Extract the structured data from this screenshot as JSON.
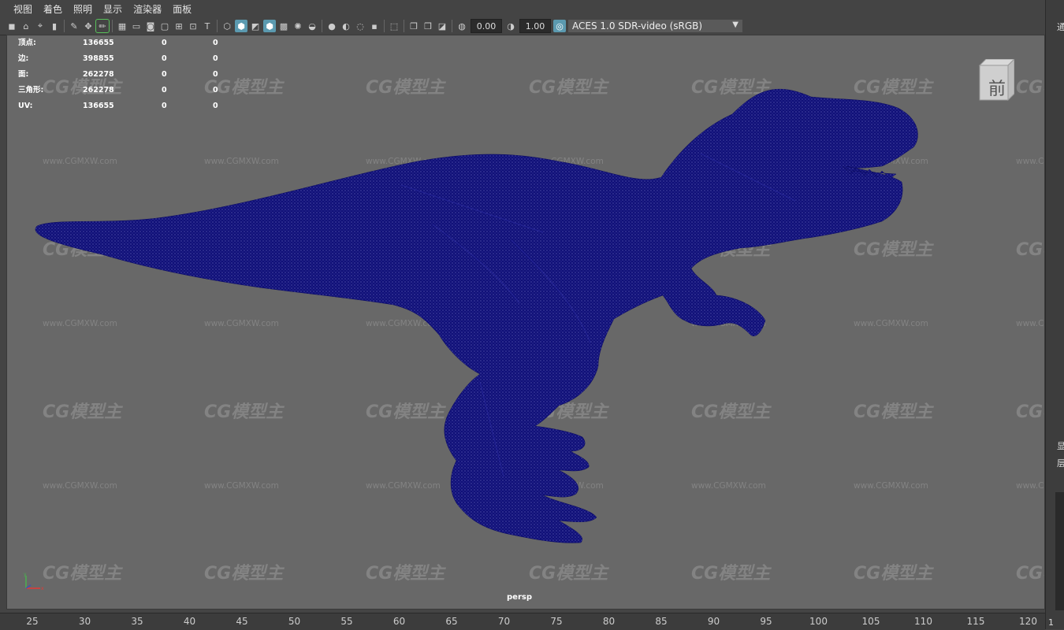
{
  "menubar": {
    "items": [
      "视图",
      "着色",
      "照明",
      "显示",
      "渲染器",
      "面板"
    ]
  },
  "toolbar": {
    "exposure_value": "0.00",
    "gamma_value": "1.00",
    "color_space": "ACES 1.0 SDR-video (sRGB)"
  },
  "hud": {
    "rows": [
      {
        "label": "顶点:",
        "a": "136655",
        "b": "0",
        "c": "0"
      },
      {
        "label": "边:",
        "a": "398855",
        "b": "0",
        "c": "0"
      },
      {
        "label": "面:",
        "a": "262278",
        "b": "0",
        "c": "0"
      },
      {
        "label": "三角形:",
        "a": "262278",
        "b": "0",
        "c": "0"
      },
      {
        "label": "UV:",
        "a": "136655",
        "b": "0",
        "c": "0"
      }
    ]
  },
  "viewcube": {
    "face_label": "前"
  },
  "viewport": {
    "camera": "persp"
  },
  "watermark": {
    "brand": "CG模型主",
    "url": "www.CGMXW.com"
  },
  "right_panel": {
    "glyphs": [
      "通",
      "显",
      "层"
    ]
  },
  "timeline": {
    "ticks": [
      "25",
      "30",
      "35",
      "40",
      "45",
      "50",
      "55",
      "60",
      "65",
      "70",
      "75",
      "80",
      "85",
      "90",
      "95",
      "100",
      "105",
      "110",
      "115",
      "120"
    ],
    "corner": "1"
  },
  "colors": {
    "mesh": "#0f0f7a",
    "viewport_bg": "#686868",
    "ui_bg": "#444444",
    "accent": "#5b9ab0"
  }
}
